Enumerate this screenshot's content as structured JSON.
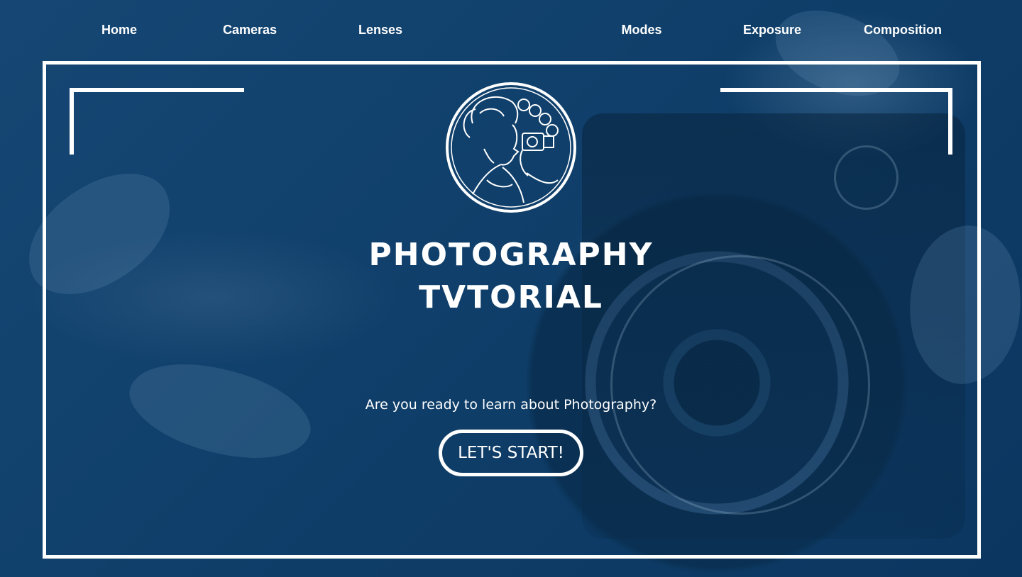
{
  "nav": {
    "items": [
      {
        "label": "Home"
      },
      {
        "label": "Cameras"
      },
      {
        "label": "Lenses"
      },
      {
        "label": "Modes"
      },
      {
        "label": "Exposure"
      },
      {
        "label": "Composition"
      }
    ]
  },
  "hero": {
    "title_line1": "PHOTOGRAPHY",
    "title_line2": "TVTORIAL",
    "subtitle": "Are you ready to learn about Photography?",
    "cta_label": "LET'S START!"
  },
  "colors": {
    "background": "#0d3d66",
    "foreground": "#ffffff"
  },
  "icons": {
    "logo": "art-nouveau-woman-with-camera-emblem"
  }
}
